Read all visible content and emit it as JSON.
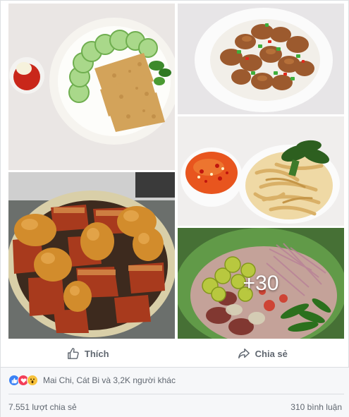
{
  "post": {
    "more_photos_label": "+30"
  },
  "actions": {
    "like_label": "Thích",
    "share_label": "Chia sẻ"
  },
  "feedback": {
    "reactions": [
      "like",
      "love",
      "wow"
    ],
    "reactors_text": "Mai Chi, Cát Bi và 3,2K người khác",
    "shares_text": "7.551 lượt chia sẻ",
    "comments_text": "310 bình luận"
  },
  "colors": {
    "like": "#3b82f5",
    "love": "#f33e58",
    "wow": "#f7c23c",
    "muted_text": "#606770"
  }
}
